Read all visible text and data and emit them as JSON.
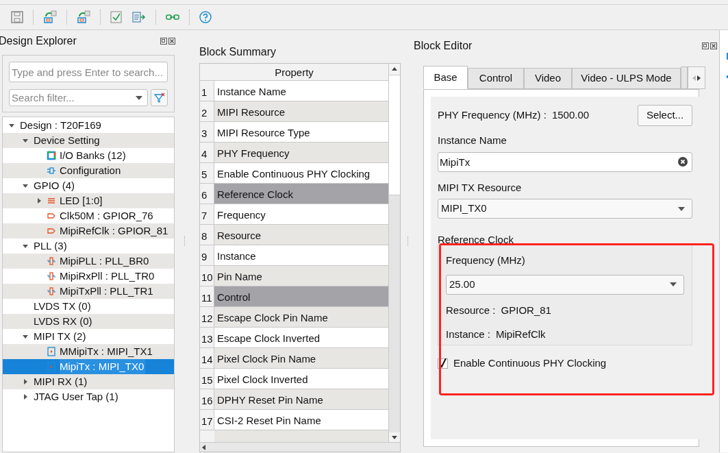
{
  "design_explorer": {
    "title": "Design Explorer",
    "search": {
      "placeholder": "Type and press Enter to search..."
    },
    "filter": {
      "placeholder": "Search filter..."
    },
    "tree": [
      {
        "label": "Design : T20F169",
        "expanded": true,
        "selected": false,
        "children": [
          {
            "label": "Device Setting",
            "expanded": true,
            "selected": false,
            "children": [
              {
                "label": "I/O Banks (12)",
                "kind": "bank",
                "selected": false
              },
              {
                "label": "Configuration",
                "kind": "config",
                "selected": false
              }
            ]
          },
          {
            "label": "GPIO (4)",
            "expanded": true,
            "selected": false,
            "children": [
              {
                "label": "LED [1:0]",
                "kind": "bus",
                "expanded": false,
                "selected": false
              },
              {
                "label": "Clk50M : GPIOR_76",
                "kind": "gpio",
                "selected": false
              },
              {
                "label": "MipiRefClk : GPIOR_81",
                "kind": "gpio",
                "selected": false
              }
            ]
          },
          {
            "label": "PLL (3)",
            "expanded": true,
            "selected": false,
            "children": [
              {
                "label": "MipiPLL : PLL_BR0",
                "kind": "pll",
                "selected": false
              },
              {
                "label": "MipiRxPll : PLL_TR0",
                "kind": "pll",
                "selected": false
              },
              {
                "label": "MipiTxPll : PLL_TR1",
                "kind": "pll",
                "selected": false
              }
            ]
          },
          {
            "label": "LVDS TX (0)",
            "selected": false
          },
          {
            "label": "LVDS RX (0)",
            "selected": false
          },
          {
            "label": "MIPI TX (2)",
            "expanded": true,
            "selected": false,
            "children": [
              {
                "label": "MMipiTx : MIPI_TX1",
                "kind": "mipi",
                "selected": false
              },
              {
                "label": "MipiTx : MIPI_TX0",
                "kind": "mipi",
                "selected": true
              }
            ]
          },
          {
            "label": "MIPI RX (1)",
            "expanded": false,
            "selected": false
          },
          {
            "label": "JTAG User Tap (1)",
            "expanded": false,
            "selected": false
          }
        ]
      }
    ]
  },
  "block_summary": {
    "title": "Block Summary",
    "columns": [
      "Property"
    ],
    "rows": [
      {
        "number": "1",
        "property": "Instance Name",
        "kind": "item"
      },
      {
        "number": "2",
        "property": "MIPI Resource",
        "kind": "item"
      },
      {
        "number": "3",
        "property": "MIPI Resource Type",
        "kind": "item"
      },
      {
        "number": "4",
        "property": "PHY Frequency",
        "kind": "item"
      },
      {
        "number": "5",
        "property": "Enable Continuous PHY Clocking",
        "kind": "item"
      },
      {
        "number": "6",
        "property": "Reference Clock",
        "kind": "section"
      },
      {
        "number": "7",
        "property": "Frequency",
        "kind": "item"
      },
      {
        "number": "8",
        "property": "Resource",
        "kind": "item"
      },
      {
        "number": "9",
        "property": "Instance",
        "kind": "item"
      },
      {
        "number": "10",
        "property": "Pin Name",
        "kind": "item"
      },
      {
        "number": "11",
        "property": "Control",
        "kind": "section"
      },
      {
        "number": "12",
        "property": "Escape Clock Pin Name",
        "kind": "item"
      },
      {
        "number": "13",
        "property": "Escape Clock Inverted",
        "kind": "item"
      },
      {
        "number": "14",
        "property": "Pixel Clock Pin Name",
        "kind": "item"
      },
      {
        "number": "15",
        "property": "Pixel Clock Inverted",
        "kind": "item"
      },
      {
        "number": "16",
        "property": "DPHY Reset Pin Name",
        "kind": "item"
      },
      {
        "number": "17",
        "property": "CSI-2 Reset Pin Name",
        "kind": "item"
      }
    ]
  },
  "block_editor": {
    "title": "Block Editor",
    "tabs": [
      {
        "label": "Base",
        "selected": true
      },
      {
        "label": "Control",
        "selected": false
      },
      {
        "label": "Video",
        "selected": false
      },
      {
        "label": "Video - ULPS Mode",
        "selected": false
      }
    ],
    "phy_frequency": {
      "label": "PHY Frequency (MHz) :",
      "value": "1500.00",
      "button": "Select..."
    },
    "instance_name": {
      "label": "Instance Name",
      "value": "MipiTx"
    },
    "mipi_tx_resource": {
      "label": "MIPI TX Resource",
      "value": "MIPI_TX0"
    },
    "reference_clock": {
      "title": "Reference Clock",
      "frequency": {
        "label": "Frequency (MHz)",
        "value": "25.00"
      },
      "resource": {
        "label": "Resource :",
        "value": "GPIOR_81"
      },
      "instance": {
        "label": "Instance :",
        "value": "MipiRefClk"
      }
    },
    "continuous_clocking": {
      "label": "Enable Continuous PHY Clocking",
      "checked": true
    }
  }
}
